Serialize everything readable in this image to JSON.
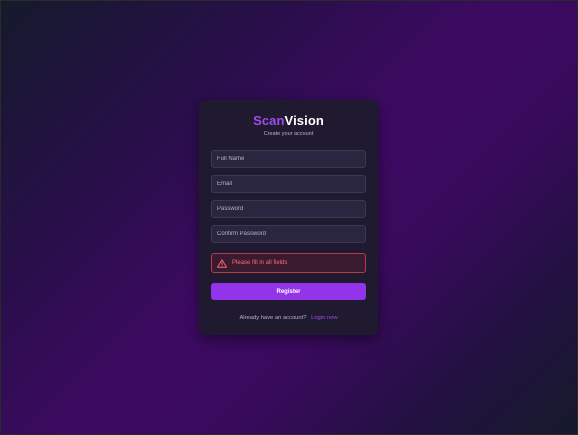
{
  "brand": {
    "part1": "Scan",
    "part2": "Vision"
  },
  "subtitle": "Create your account",
  "form": {
    "full_name_placeholder": "Full Name",
    "email_placeholder": "Email",
    "password_placeholder": "Password",
    "confirm_password_placeholder": "Confirm Password"
  },
  "error": {
    "icon": "warning-triangle-icon",
    "message": "Please fill in all fields"
  },
  "register_label": "Register",
  "footer": {
    "text": "Already have an account?",
    "link": "Login now"
  },
  "colors": {
    "accent": "#9333ea",
    "brand_accent": "#a24bf0",
    "error": "#ff6b7a",
    "card_bg": "#1f1a30"
  }
}
